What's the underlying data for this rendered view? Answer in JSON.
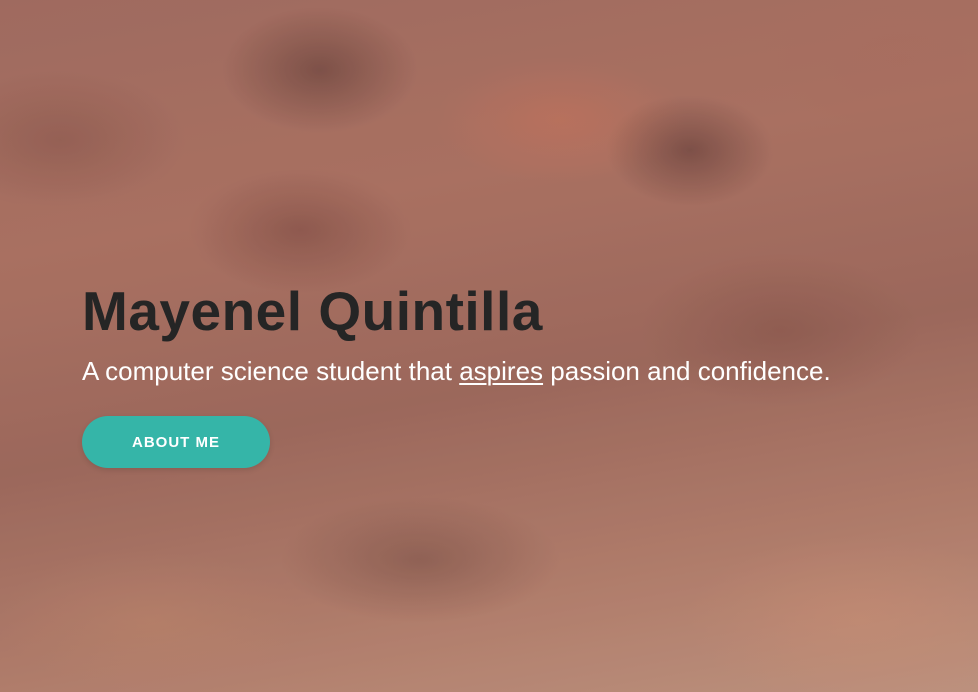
{
  "hero": {
    "title": "Mayenel Quintilla",
    "subtitle": {
      "before": "A computer science student that ",
      "link": "aspires",
      "after": " passion and confidence."
    },
    "button_label": "ABOUT ME",
    "colors": {
      "accent": "#35b5a8",
      "title_text": "#252525",
      "subtitle_text": "#ffffff"
    },
    "background": "cloudy-sunset-sky-photo"
  }
}
